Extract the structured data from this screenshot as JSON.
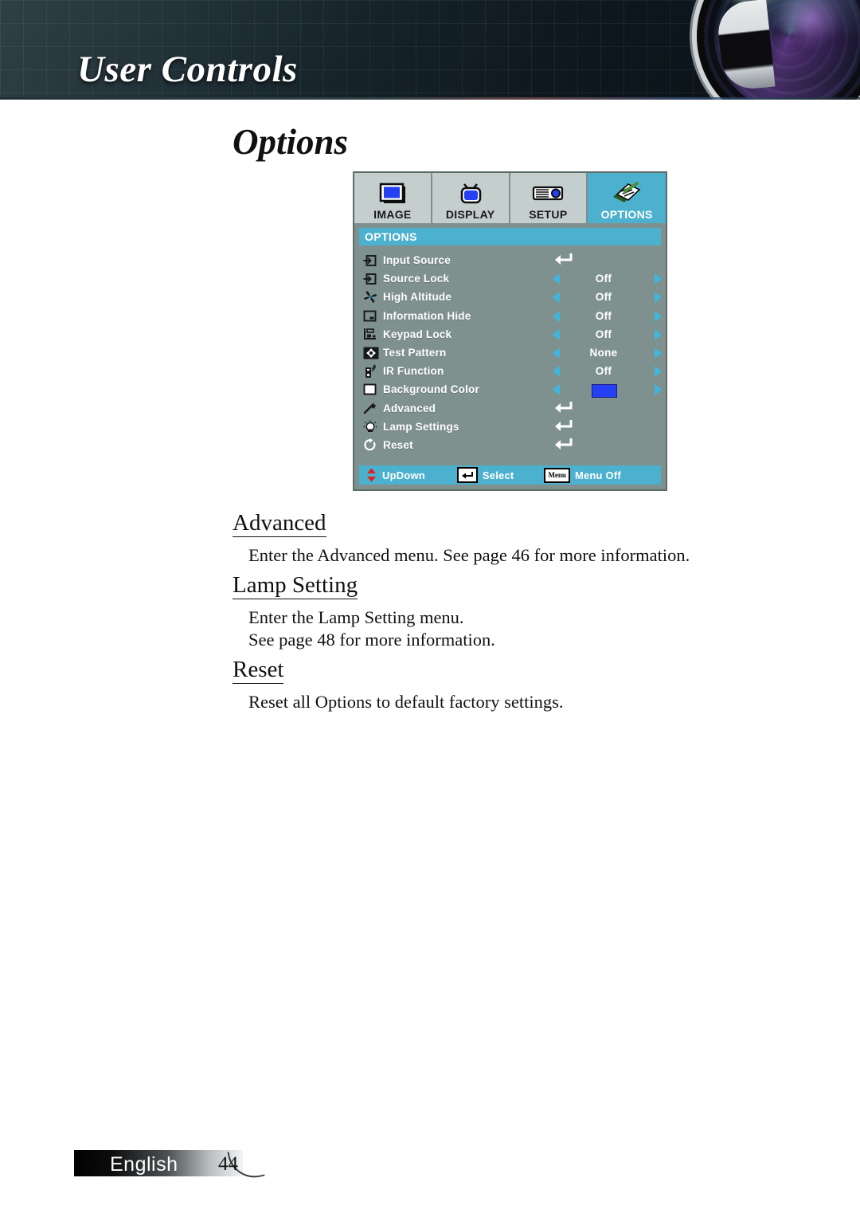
{
  "header": {
    "title": "User Controls",
    "lens_icon": "camera-lens-graphic"
  },
  "page_title": "Options",
  "osd": {
    "tabs": [
      {
        "label": "IMAGE",
        "icon": "monitor-icon",
        "active": false
      },
      {
        "label": "DISPLAY",
        "icon": "television-icon",
        "active": false
      },
      {
        "label": "SETUP",
        "icon": "projector-icon",
        "active": false
      },
      {
        "label": "OPTIONS",
        "icon": "document-pencil-icon",
        "active": true
      }
    ],
    "title_bar": "OPTIONS",
    "rows": [
      {
        "label": "Input Source",
        "icon": "input-source-icon",
        "control": "enter",
        "value": ""
      },
      {
        "label": "Source Lock",
        "icon": "source-lock-icon",
        "control": "spinner",
        "value": "Off"
      },
      {
        "label": "High Altitude",
        "icon": "fan-icon",
        "control": "spinner",
        "value": "Off"
      },
      {
        "label": "Information Hide",
        "icon": "information-hide-icon",
        "control": "spinner",
        "value": "Off"
      },
      {
        "label": "Keypad Lock",
        "icon": "keypad-lock-icon",
        "control": "spinner",
        "value": "Off"
      },
      {
        "label": "Test Pattern",
        "icon": "test-pattern-icon",
        "control": "spinner",
        "value": "None"
      },
      {
        "label": "IR Function",
        "icon": "remote-control-icon",
        "control": "spinner",
        "value": "Off"
      },
      {
        "label": "Background Color",
        "icon": "background-color-icon",
        "control": "color",
        "value": "#2440f2"
      },
      {
        "label": "Advanced",
        "icon": "magic-wand-icon",
        "control": "enter",
        "value": ""
      },
      {
        "label": "Lamp Settings",
        "icon": "lamp-bulb-icon",
        "control": "enter",
        "value": ""
      },
      {
        "label": "Reset",
        "icon": "reset-arrow-icon",
        "control": "enter",
        "value": ""
      }
    ],
    "footer": [
      {
        "label": "UpDown",
        "icon": "up-down-arrow-icon"
      },
      {
        "label": "Select",
        "icon": "enter-key-icon"
      },
      {
        "label": "Menu Off",
        "icon": "menu-key-icon",
        "key_text": "Menu"
      }
    ],
    "colors": {
      "panel_bg": "#7f918f",
      "accent_cyan": "#4cb0cf",
      "arrow_cyan": "#3fb6de",
      "tab_bg": "#c3cecd",
      "swatch_blue": "#2440f2"
    }
  },
  "sections": [
    {
      "heading": "Advanced",
      "lines": [
        "Enter the Advanced menu. See page 46 for more information."
      ]
    },
    {
      "heading": "Lamp Setting",
      "lines": [
        "Enter the Lamp Setting menu.",
        "See page 48 for more information."
      ]
    },
    {
      "heading": "Reset",
      "lines": [
        "Reset all Options to default factory settings."
      ]
    }
  ],
  "footer": {
    "language": "English",
    "page_number": "44"
  }
}
